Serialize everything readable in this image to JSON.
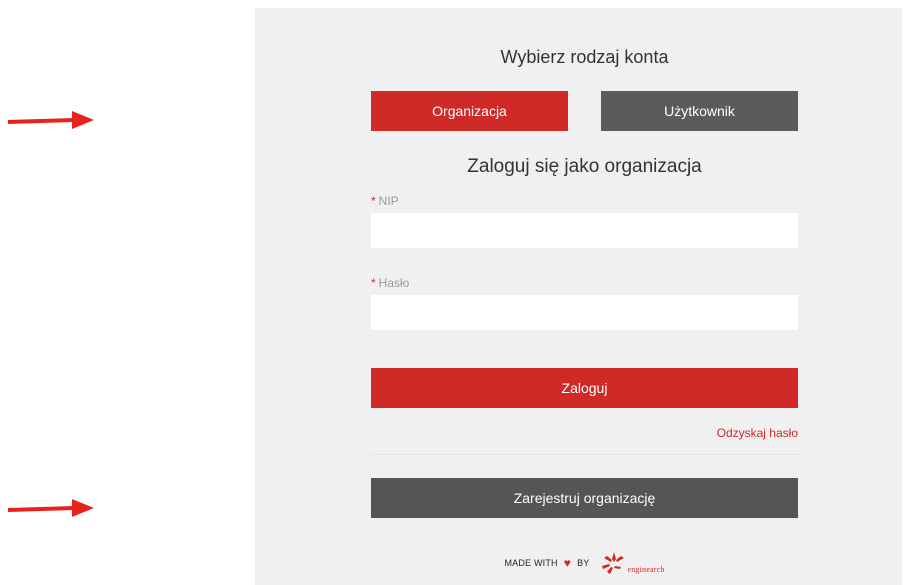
{
  "account_selector": {
    "heading": "Wybierz rodzaj konta",
    "organization_label": "Organizacja",
    "user_label": "Użytkownik"
  },
  "login": {
    "heading": "Zaloguj się jako organizacja",
    "required_marker": "*",
    "nip_label": "NIP",
    "nip_value": "",
    "password_label": "Hasło",
    "password_value": "",
    "submit_label": "Zaloguj",
    "forgot_label": "Odzyskaj hasło",
    "register_label": "Zarejestruj organizację"
  },
  "footer": {
    "made_with": "MADE WITH",
    "by": "BY",
    "brand": "enginearch"
  },
  "colors": {
    "accent": "#cf2a27",
    "dark_button": "#5b5b5b",
    "panel_background": "#f0f0f0"
  }
}
